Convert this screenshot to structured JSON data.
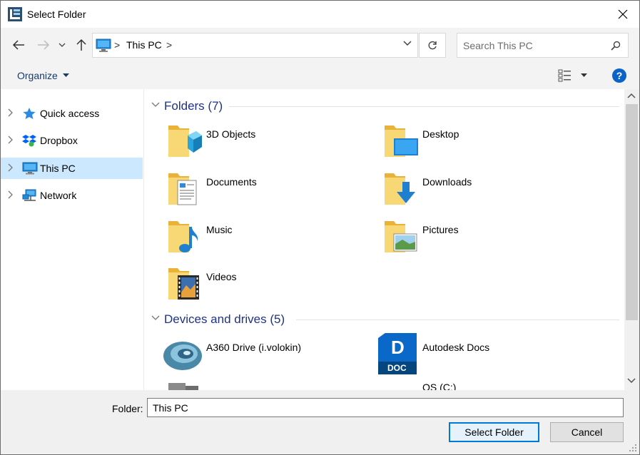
{
  "window": {
    "title": "Select Folder"
  },
  "address": {
    "location": "This PC",
    "sep1": ">",
    "sep2": ">"
  },
  "search": {
    "placeholder": "Search This PC"
  },
  "command_bar": {
    "organize_label": "Organize",
    "help_label": "?"
  },
  "nav_pane": {
    "items": [
      {
        "label": "Quick access",
        "icon": "star-icon"
      },
      {
        "label": "Dropbox",
        "icon": "dropbox-icon"
      },
      {
        "label": "This PC",
        "icon": "computer-icon",
        "selected": true
      },
      {
        "label": "Network",
        "icon": "network-icon"
      }
    ]
  },
  "content": {
    "folders_group": {
      "title": "Folders (7)"
    },
    "folders": [
      {
        "label": "3D Objects",
        "icon": "3d-objects-folder-icon"
      },
      {
        "label": "Desktop",
        "icon": "desktop-folder-icon"
      },
      {
        "label": "Documents",
        "icon": "documents-folder-icon"
      },
      {
        "label": "Downloads",
        "icon": "downloads-folder-icon"
      },
      {
        "label": "Music",
        "icon": "music-folder-icon"
      },
      {
        "label": "Pictures",
        "icon": "pictures-folder-icon"
      },
      {
        "label": "Videos",
        "icon": "videos-folder-icon"
      }
    ],
    "drives_group": {
      "title": "Devices and drives (5)"
    },
    "drives": [
      {
        "label": "A360 Drive (i.volokin)",
        "icon": "a360-drive-icon"
      },
      {
        "label": "Autodesk Docs",
        "icon": "autodesk-docs-icon",
        "badge_letter": "D",
        "badge_text": "DOC"
      },
      {
        "label": "",
        "icon": "drive-icon"
      },
      {
        "label": "OS (C:)",
        "icon": "hard-drive-icon"
      }
    ]
  },
  "footer": {
    "folder_label": "Folder:",
    "folder_value": "This PC",
    "select_button": "Select Folder",
    "cancel_button": "Cancel"
  },
  "colors": {
    "accent": "#0078d7",
    "selection": "#cce8ff",
    "group_title": "#1e3287",
    "folder_yellow": "#f5c944"
  }
}
